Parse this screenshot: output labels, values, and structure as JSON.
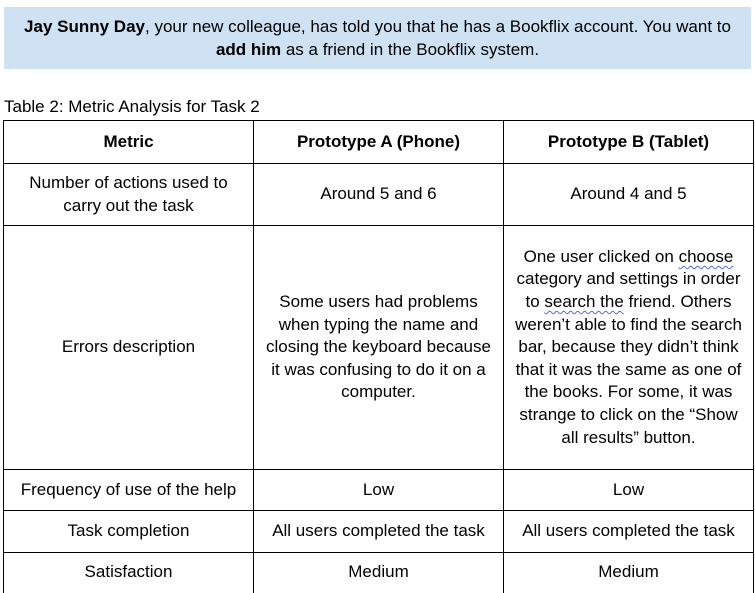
{
  "task": {
    "part1": "Jay Sunny Day",
    "part2": ", your new colleague, has told you that he has a Bookflix account. You want to ",
    "part3": "add him",
    "part4": " as a friend in the Bookflix system."
  },
  "caption": "Table 2: Metric Analysis for Task 2",
  "columns": [
    "Metric",
    "Prototype A (Phone)",
    "Prototype B (Tablet)"
  ],
  "rows": {
    "actions": [
      "Number of actions used to carry out the task",
      "Around 5 and 6",
      "Around 4 and 5"
    ],
    "errors": {
      "metric": "Errors description",
      "a": "Some users had problems when typing the name and closing the keyboard because it was confusing to do it on a computer.",
      "b1": "One user clicked on ",
      "b2": "choose",
      "b3": " category and settings in order to ",
      "b4": "search the",
      "b5": " friend. Others weren’t able to find the search bar, because they didn’t think that it was the same as one of the books. For some, it was strange to click on the “Show all results” button."
    },
    "help": [
      "Frequency of use of the help",
      "Low",
      "Low"
    ],
    "completion": [
      "Task completion",
      "All users completed the task",
      "All users completed the task"
    ],
    "satisfaction": [
      "Satisfaction",
      "Medium",
      "Medium"
    ]
  },
  "colors": {
    "task_box_background": "#cfe2f3",
    "spellcheck_underline": "#4a6fd4"
  }
}
